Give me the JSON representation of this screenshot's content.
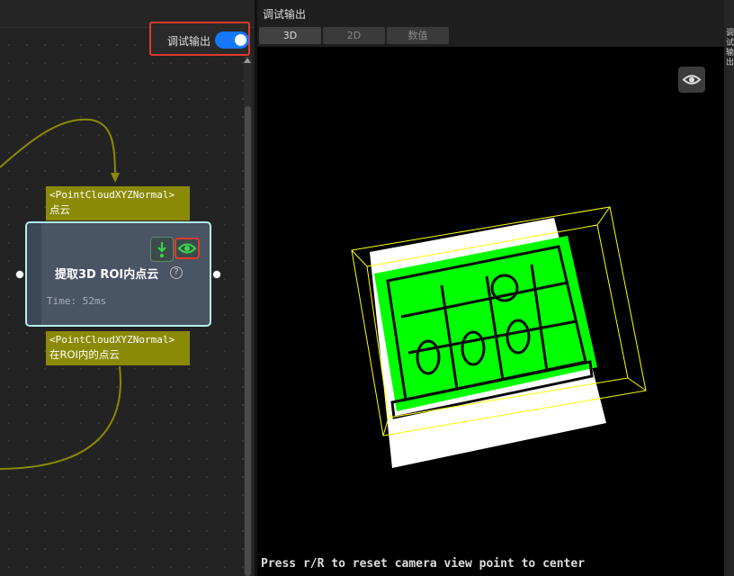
{
  "graph": {
    "debug_toggle": {
      "label": "调试输出",
      "enabled": true,
      "accent": "#1677ff"
    },
    "input_port": {
      "type": "<PointCloudXYZNormal>",
      "name": "点云",
      "color": "#8b8a07"
    },
    "node": {
      "title": "提取3D ROI内点云",
      "help": "?",
      "time": "Time: 52ms",
      "border_color": "#b4f1ef"
    },
    "output_port": {
      "type": "<PointCloudXYZNormal>",
      "name": "在ROI内的点云",
      "color": "#8b8a07"
    },
    "wire_color": "#8b8a07",
    "highlight_color": "#e0392b"
  },
  "output": {
    "title": "调试输出",
    "tabs": [
      {
        "label": "3D",
        "active": true
      },
      {
        "label": "2D",
        "active": false
      },
      {
        "label": "数值",
        "active": false
      }
    ],
    "hint": "Press r/R to reset camera view point to center",
    "side_label": "调试输出",
    "point_cloud_color": "#00ff00",
    "bbox_color": "#ffff00"
  },
  "icons": [
    "eye-icon",
    "download-arrow-icon",
    "help-icon",
    "scroll-up-icon"
  ]
}
